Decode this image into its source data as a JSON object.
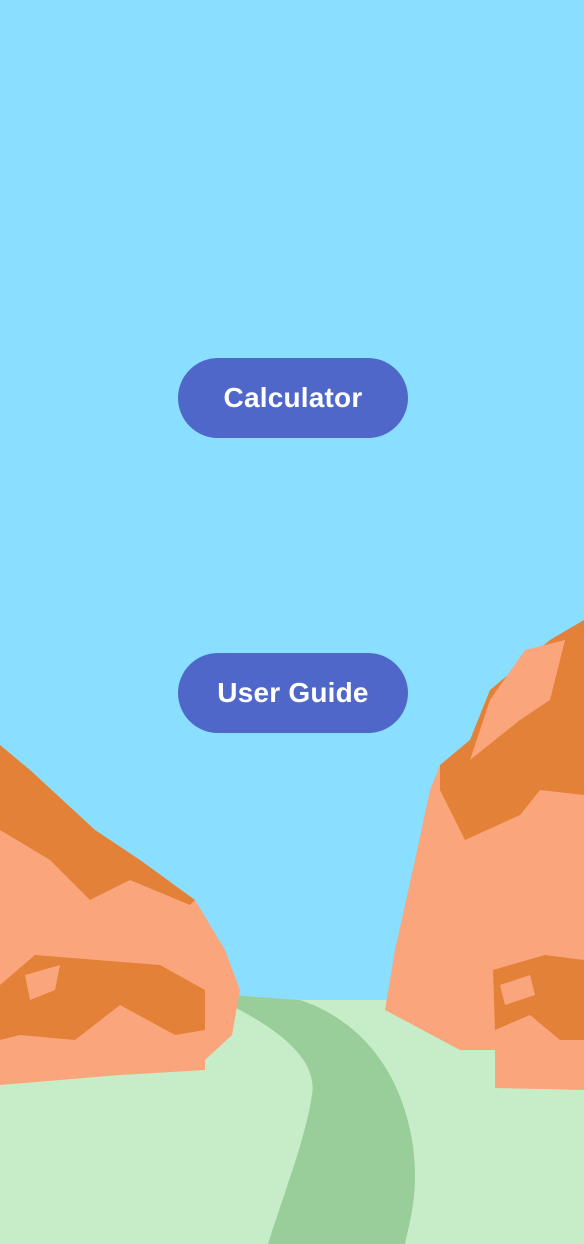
{
  "colors": {
    "sky": "#8ADEFF",
    "button_bg": "#4F67C9",
    "button_text": "#FFFFFF",
    "grass": "#C6EDC8",
    "path": "#99CE9B",
    "rock_light": "#FBA57C",
    "rock_dark": "#E38138"
  },
  "menu": {
    "calculator_label": "Calculator",
    "user_guide_label": "User Guide"
  }
}
